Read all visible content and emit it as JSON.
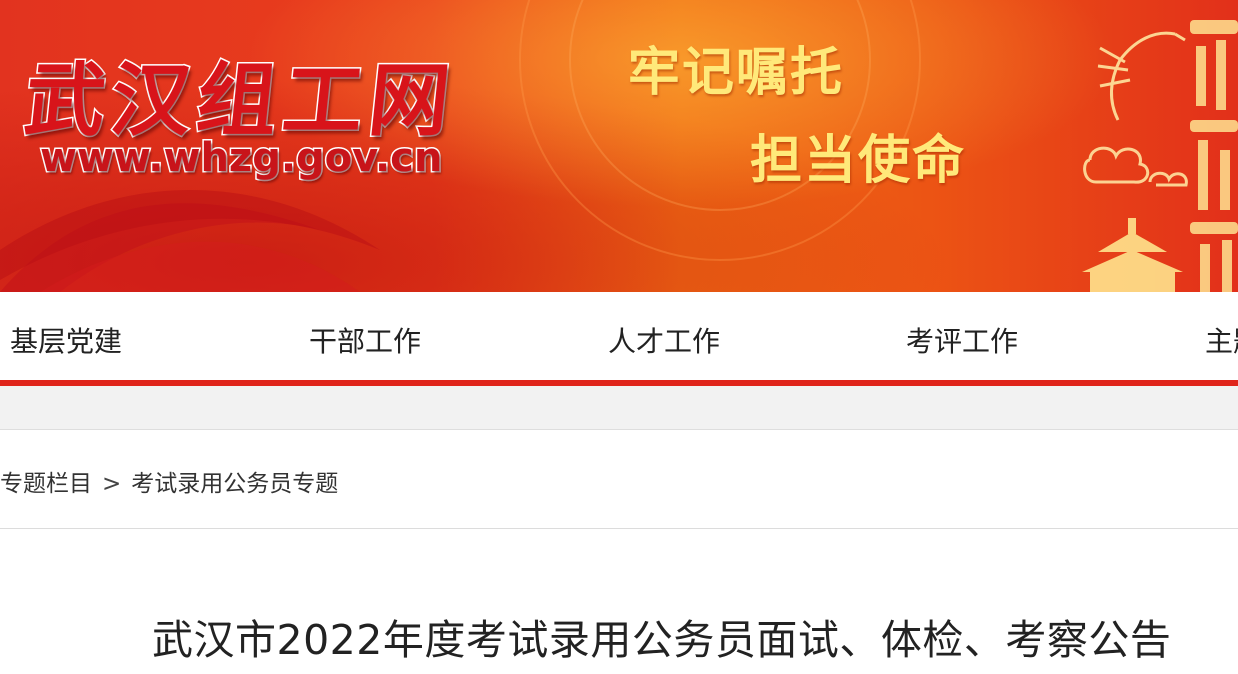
{
  "header": {
    "logo_text": "武汉组工网",
    "url_text": "www.whzg.gov.cn",
    "slogan_line1": "牢记嘱托",
    "slogan_line2": "担当使命",
    "colors": {
      "banner_red": "#e2331f",
      "banner_orange": "#f06a14",
      "slogan_gold": "#ffe97a",
      "accent_red": "#e0251b"
    }
  },
  "nav": {
    "items": [
      {
        "label": "基层党建"
      },
      {
        "label": "干部工作"
      },
      {
        "label": "人才工作"
      },
      {
        "label": "考评工作"
      },
      {
        "label": "主题"
      }
    ]
  },
  "breadcrumb": {
    "items": [
      {
        "label": "专题栏目"
      },
      {
        "label": "考试录用公务员专题"
      }
    ],
    "separator": ">"
  },
  "article": {
    "title": "武汉市2022年度考试录用公务员面试、体检、考察公告"
  }
}
